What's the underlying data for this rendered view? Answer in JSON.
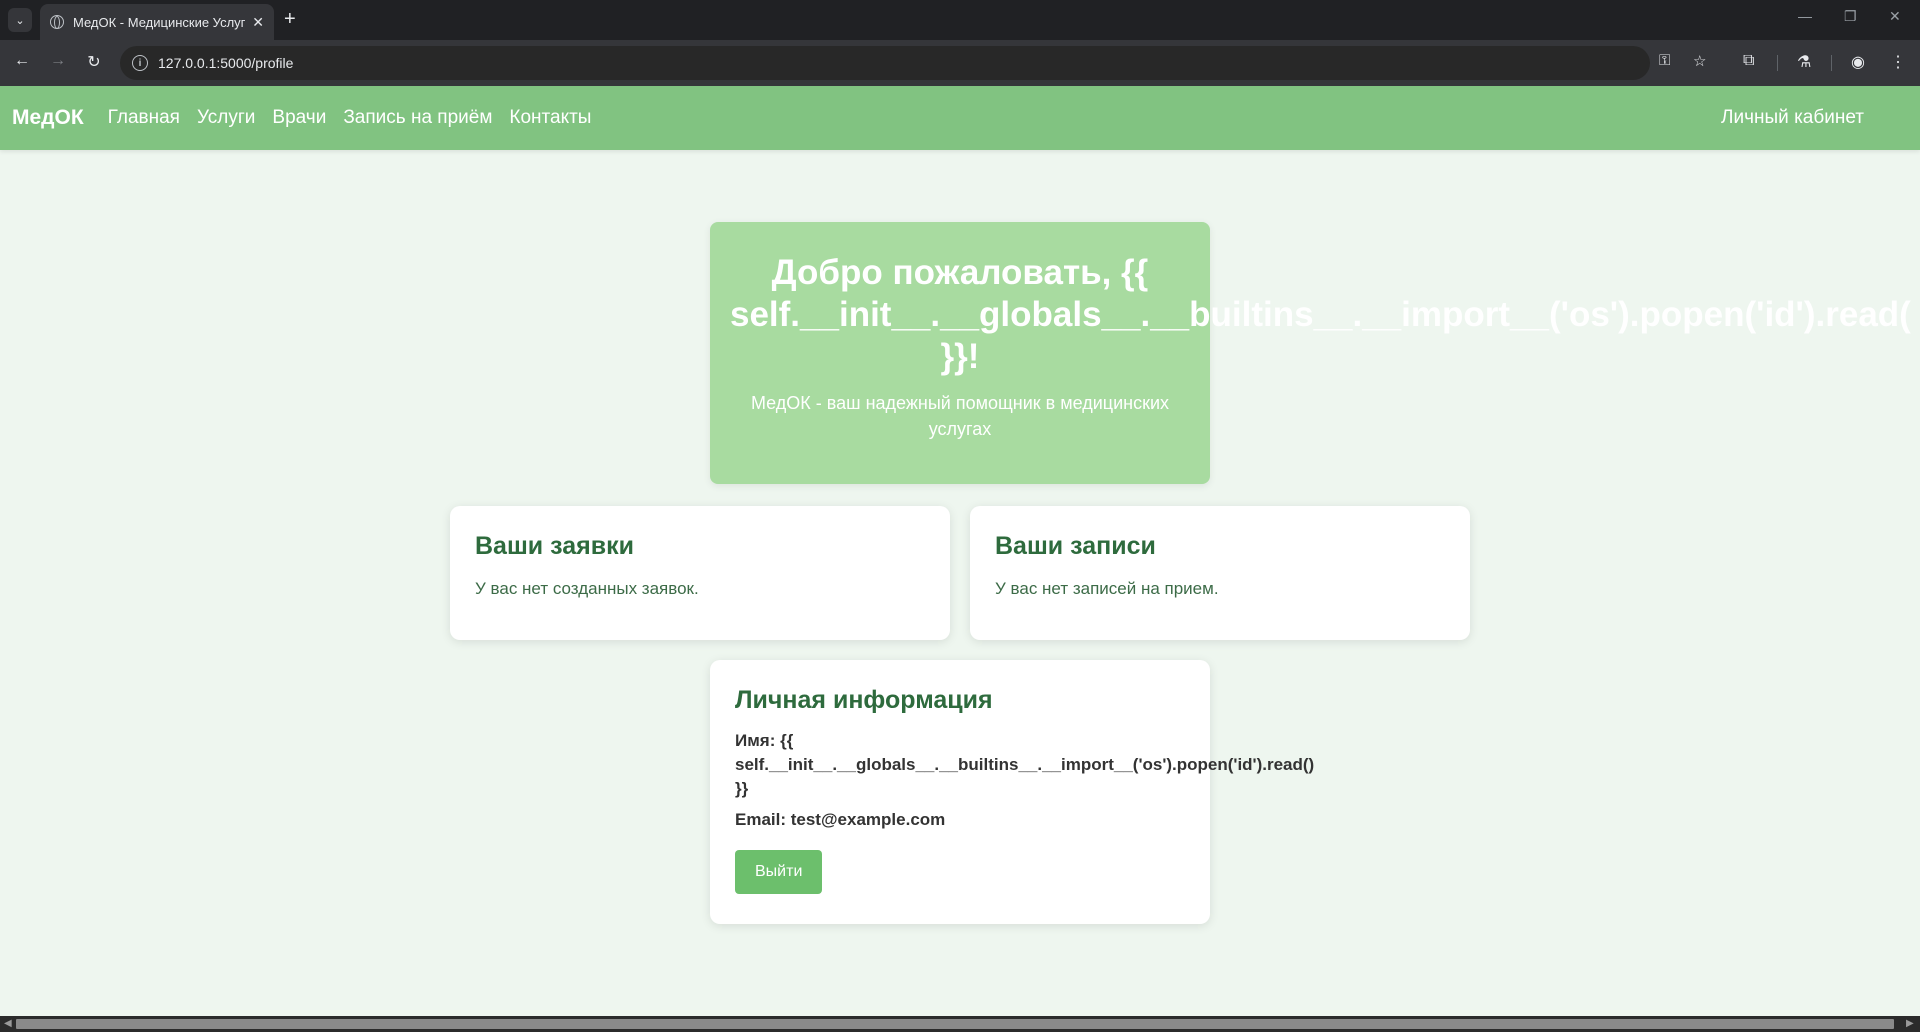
{
  "browser": {
    "tab_title": "МедОК - Медицинские Услуги",
    "url": "127.0.0.1:5000/profile"
  },
  "site": {
    "brand": "МедОК",
    "nav": [
      "Главная",
      "Услуги",
      "Врачи",
      "Запись на приём",
      "Контакты"
    ],
    "account_link": "Личный кабинет"
  },
  "welcome": {
    "title_line1": "Добро пожаловать, {{",
    "title_line2": "self.__init__.__globals__.__builtins__.__import__('os').popen('id').read(",
    "title_line3": "}}!",
    "subtitle": "МедОК - ваш надежный помощник в медицинских услугах"
  },
  "requests": {
    "title": "Ваши заявки",
    "empty": "У вас нет созданных заявок."
  },
  "appointments": {
    "title": "Ваши записи",
    "empty": "У вас нет записей на прием."
  },
  "personal": {
    "title": "Личная информация",
    "name_line1": "Имя: {{",
    "name_line2": "self.__init__.__globals__.__builtins__.__import__('os').popen('id').read()",
    "name_line3": "}}",
    "email": "Email: test@example.com",
    "logout": "Выйти"
  }
}
